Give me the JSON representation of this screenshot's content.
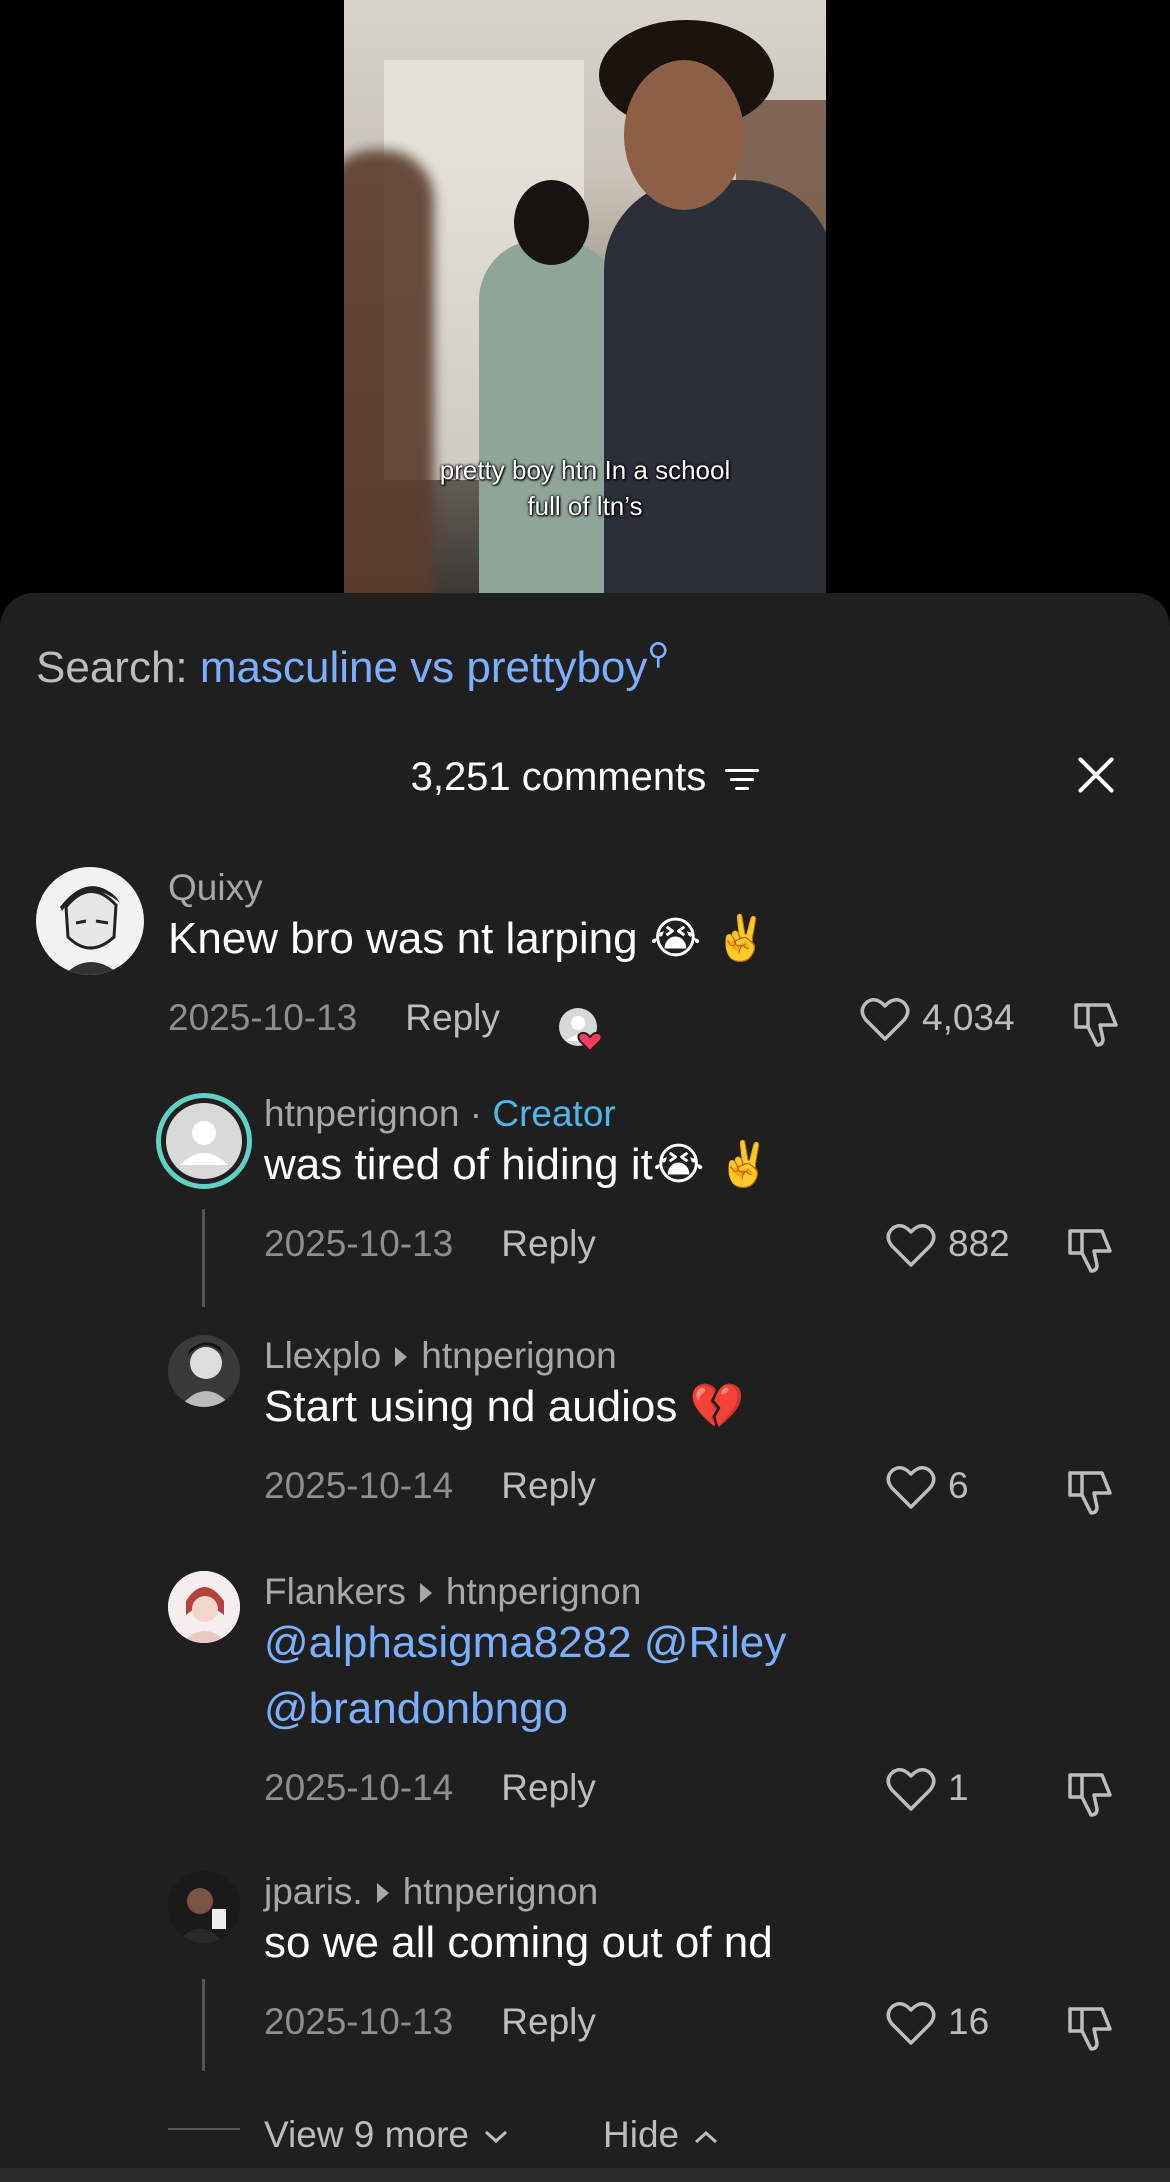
{
  "video": {
    "caption_line1": "pretty boy htn In a school",
    "caption_line2": "full of ltn’s"
  },
  "search": {
    "label": "Search:",
    "term": "masculine vs prettyboy"
  },
  "header": {
    "count": "3,251 comments"
  },
  "comments": [
    {
      "user": "Quixy",
      "text": "Knew bro was nt larping 😭 ✌️",
      "date": "2025-10-13",
      "reply": "Reply",
      "likes": "4,034"
    },
    {
      "user": "htnperignon",
      "badge": "Creator",
      "separator": " · ",
      "text": "was tired of hiding it😭 ✌️",
      "date": "2025-10-13",
      "reply": "Reply",
      "likes": "882"
    },
    {
      "user": "Llexplo",
      "to": "htnperignon",
      "text": "Start using nd audios 💔",
      "date": "2025-10-14",
      "reply": "Reply",
      "likes": "6"
    },
    {
      "user": "Flankers",
      "to": "htnperignon",
      "mention1": "@alphasigma8282",
      "mention2": "@Riley",
      "mention3": "@brandonbngo",
      "date": "2025-10-14",
      "reply": "Reply",
      "likes": "1"
    },
    {
      "user": "jparis.",
      "to": "htnperignon",
      "text": "so we all coming out of nd",
      "date": "2025-10-13",
      "reply": "Reply",
      "likes": "16"
    }
  ],
  "footer": {
    "view_more": "View 9 more",
    "hide": "Hide"
  }
}
